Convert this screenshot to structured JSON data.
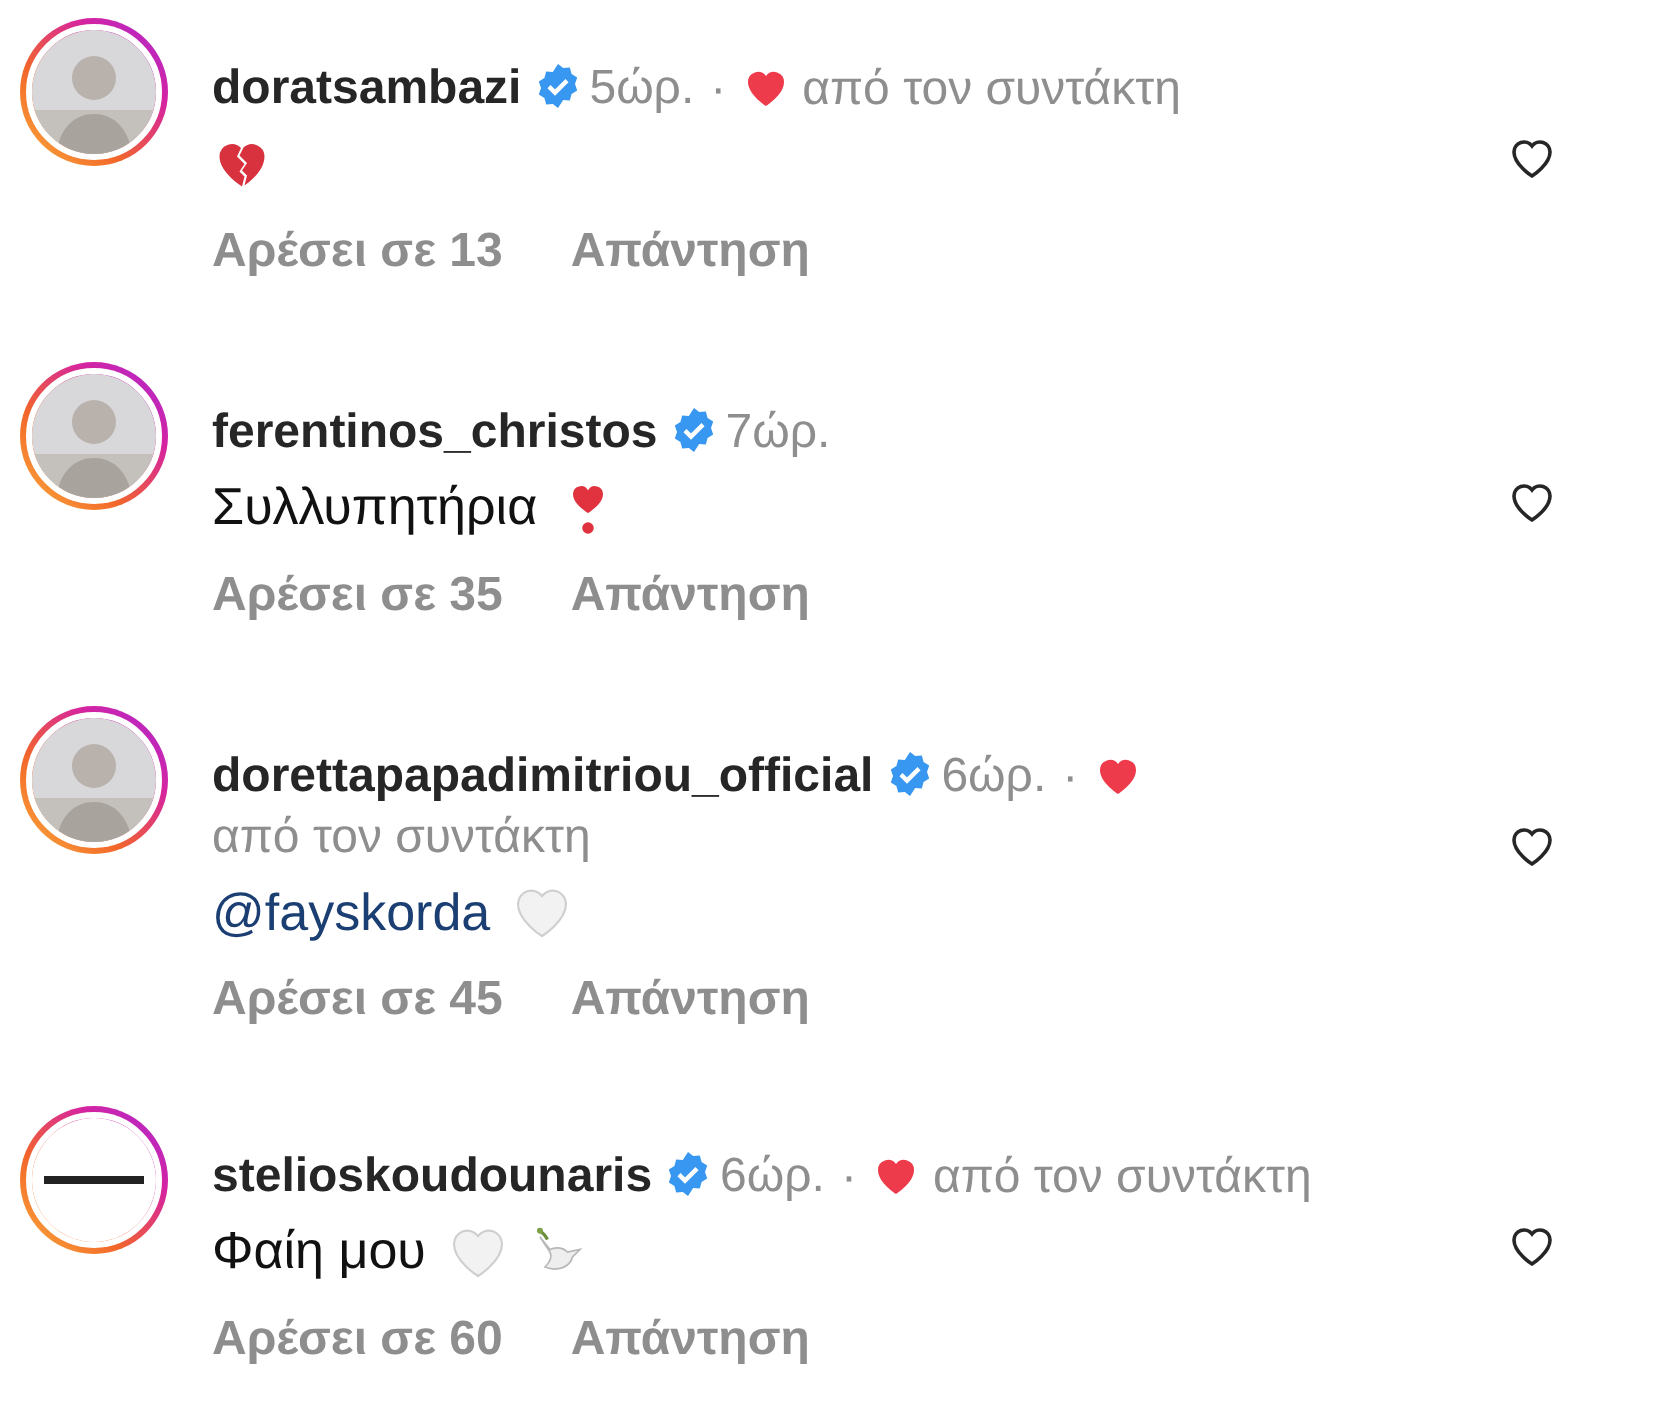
{
  "comments": [
    {
      "username": "doratsambazi",
      "verified": true,
      "time": "5ώρ.",
      "separator": "·",
      "liked_by_author": true,
      "author_label": "από τον συντάκτη",
      "avatar": {
        "kind": "picture",
        "ring": true
      },
      "body": {
        "emojis": [
          {
            "kind": "broken_heart"
          }
        ]
      },
      "likes": "Αρέσει σε 13",
      "reply": "Απάντηση",
      "liked": false
    },
    {
      "username": "ferentinos_christos",
      "verified": true,
      "time": "7ώρ.",
      "liked_by_author": false,
      "avatar": {
        "kind": "picture",
        "ring": true
      },
      "body": {
        "text": "Συλλυπητήρια",
        "emojis": [
          {
            "kind": "heart_exclamation"
          }
        ]
      },
      "likes": "Αρέσει σε 35",
      "reply": "Απάντηση",
      "liked": false
    },
    {
      "username": "dorettapapadimitriou_official",
      "verified": true,
      "time": "6ώρ.",
      "separator": "·",
      "liked_by_author": true,
      "author_label": "από τον συντάκτη",
      "avatar": {
        "kind": "picture",
        "ring": true
      },
      "body": {
        "text": "@fayskorda",
        "mention": true,
        "emojis": [
          {
            "kind": "white_heart"
          }
        ]
      },
      "likes": "Αρέσει σε 45",
      "reply": "Απάντηση",
      "liked": false
    },
    {
      "username": "stelioskoudounaris",
      "verified": true,
      "time": "6ώρ.",
      "separator": "·",
      "liked_by_author": true,
      "author_label": "από τον συντάκτη",
      "avatar": {
        "kind": "logo",
        "ring": true
      },
      "body": {
        "text": "Φαίη μου",
        "emojis": [
          {
            "kind": "white_heart"
          },
          {
            "kind": "dove"
          }
        ]
      },
      "likes": "Αρέσει σε 60",
      "reply": "Απάντηση",
      "liked": false
    }
  ]
}
